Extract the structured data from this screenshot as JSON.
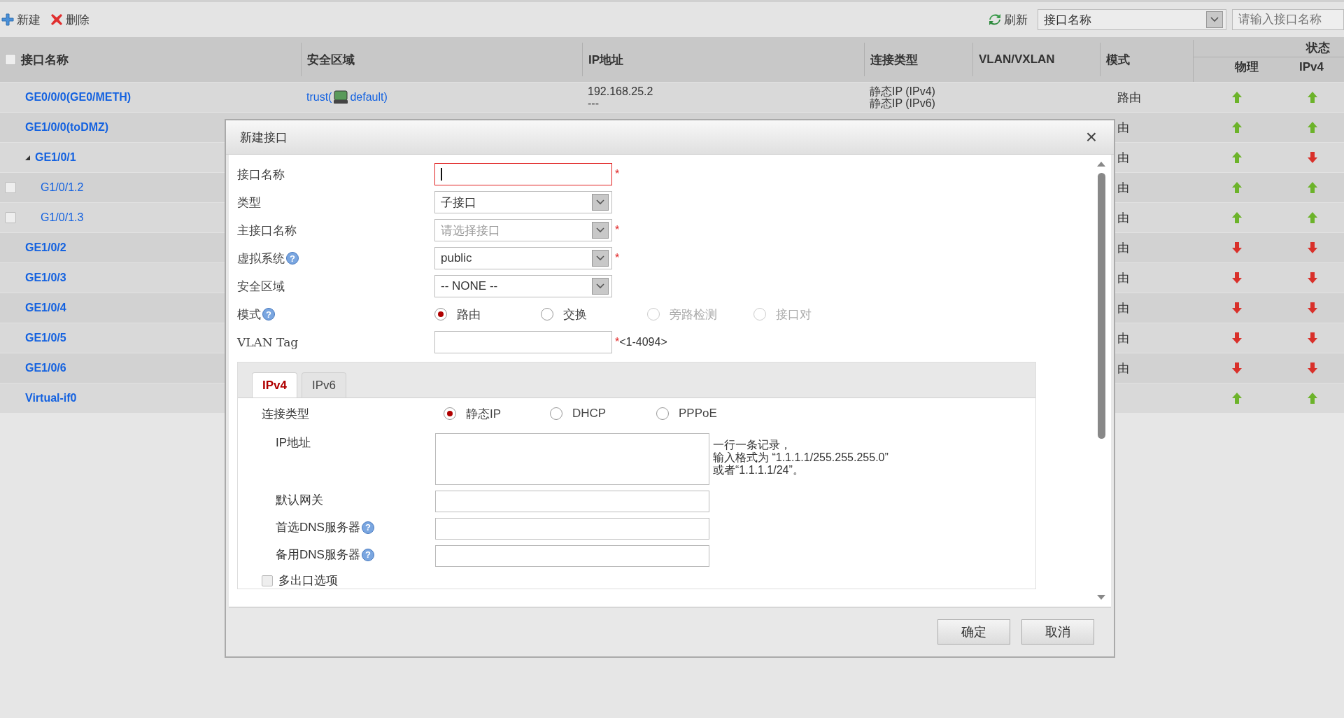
{
  "toolbar": {
    "new": "新建",
    "delete": "删除",
    "refresh": "刷新",
    "filter_select": "接口名称",
    "search": {
      "placeholder": "请输入接口名称"
    }
  },
  "table": {
    "columns": [
      "接口名称",
      "安全区域",
      "IP地址",
      "连接类型",
      "VLAN/VXLAN",
      "模式"
    ],
    "status_header": "状态",
    "status_columns": [
      "物理",
      "IPv4"
    ],
    "header_checked": false,
    "rows": [
      {
        "name": "GE0/0/0(GE0/METH)",
        "zone_prefix": "trust(",
        "zone_suffix": "default)",
        "ip": [
          "192.168.25.2",
          "---"
        ],
        "connection": [
          "静态IP (IPv4)",
          "静态IP (IPv6)"
        ],
        "mode": "路由",
        "physical_up": true,
        "ipv4_up": true
      },
      {
        "name": "GE1/0/0(toDMZ)",
        "mode": "由",
        "physical_up": true,
        "ipv4_up": true
      },
      {
        "name": "GE1/0/1",
        "expanded": true,
        "mode": "由",
        "physical_up": true,
        "ipv4_up": false,
        "children": [
          {
            "name": "G1/0/1.2",
            "checked": false,
            "mode": "由",
            "physical_up": true,
            "ipv4_up": true
          },
          {
            "name": "G1/0/1.3",
            "checked": false,
            "mode": "由",
            "physical_up": true,
            "ipv4_up": true
          }
        ]
      },
      {
        "name": "GE1/0/2",
        "mode": "由",
        "physical_up": false,
        "ipv4_up": false
      },
      {
        "name": "GE1/0/3",
        "mode": "由",
        "physical_up": false,
        "ipv4_up": false
      },
      {
        "name": "GE1/0/4",
        "mode": "由",
        "physical_up": false,
        "ipv4_up": false
      },
      {
        "name": "GE1/0/5",
        "mode": "由",
        "physical_up": false,
        "ipv4_up": false
      },
      {
        "name": "GE1/0/6",
        "mode": "由",
        "physical_up": false,
        "ipv4_up": false
      },
      {
        "name": "Virtual-if0",
        "physical_up": true,
        "ipv4_up": true
      }
    ]
  },
  "dialog": {
    "title": "新建接口",
    "close": "×",
    "fields": [
      {
        "kind": "input",
        "label": "接口名称",
        "focused": true,
        "required": "*"
      },
      {
        "kind": "select",
        "label": "类型",
        "value": "子接口"
      },
      {
        "kind": "select",
        "label": "主接口名称",
        "placeholder": "请选择接口",
        "required": "*"
      },
      {
        "kind": "select",
        "label": "虚拟系统",
        "help": "?",
        "value": "public",
        "required": "*"
      },
      {
        "kind": "select",
        "label": "安全区域",
        "value": "-- NONE --"
      },
      {
        "kind": "radio",
        "label": "模式",
        "help": "?",
        "options": [
          {
            "label": "路由",
            "selected": true,
            "disabled": false
          },
          {
            "label": "交换",
            "selected": false,
            "disabled": false
          },
          {
            "label": "旁路检测",
            "selected": false,
            "disabled": true
          },
          {
            "label": "接口对",
            "selected": false,
            "disabled": true
          }
        ]
      },
      {
        "kind": "input",
        "label": "VLAN Tag",
        "required": "*",
        "hint": "<1-4094>"
      }
    ],
    "tabs": [
      {
        "label": "IPv4",
        "selected": true
      },
      {
        "label": "IPv6",
        "selected": false
      }
    ],
    "connection": {
      "label": "连接类型",
      "options": [
        {
          "label": "静态IP",
          "selected": true
        },
        {
          "label": "DHCP",
          "selected": false
        },
        {
          "label": "PPPoE",
          "selected": false
        }
      ]
    },
    "ip_fields": [
      {
        "kind": "textarea",
        "label": "IP地址",
        "hint": [
          "一行一条记录，",
          "输入格式为 “1.1.1.1/255.255.255.0”",
          "或者“1.1.1.1/24”。"
        ]
      },
      {
        "kind": "input",
        "label": "默认网关"
      },
      {
        "kind": "input",
        "label": "首选DNS服务器",
        "help": "?"
      },
      {
        "kind": "input",
        "label": "备用DNS服务器",
        "help": "?"
      }
    ],
    "multi_exit": {
      "label": "多出口选项",
      "checked": false
    },
    "buttons": [
      "确定",
      "取消"
    ]
  }
}
